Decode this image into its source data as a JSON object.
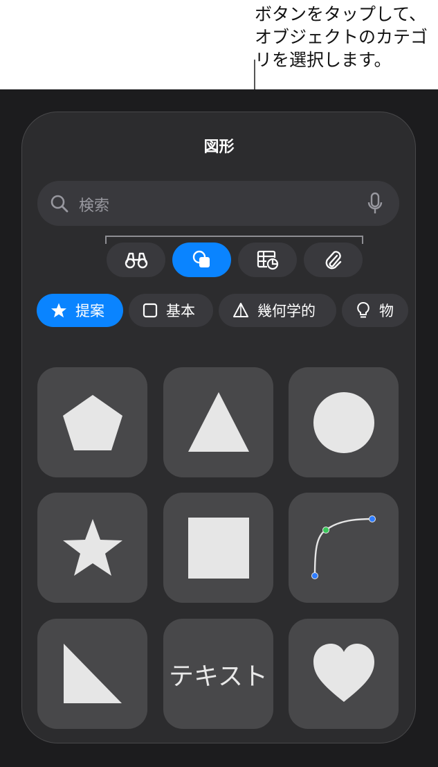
{
  "callout": {
    "text": "ボタンをタップして、\nオブジェクトのカテゴ\nリを選択します。"
  },
  "panel": {
    "title": "図形"
  },
  "search": {
    "placeholder": "検索"
  },
  "category_buttons": [
    {
      "icon": "binoculars-icon",
      "active": false
    },
    {
      "icon": "shapes-icon",
      "active": true
    },
    {
      "icon": "table-chart-icon",
      "active": false
    },
    {
      "icon": "paperclip-icon",
      "active": false
    }
  ],
  "chips": [
    {
      "label": "提案",
      "icon": "star-icon",
      "active": true
    },
    {
      "label": "基本",
      "icon": "square-icon",
      "active": false
    },
    {
      "label": "幾何学的",
      "icon": "pyramid-icon",
      "active": false
    },
    {
      "label": "物",
      "icon": "lightbulb-icon",
      "active": false
    }
  ],
  "shapes": [
    {
      "name": "pentagon"
    },
    {
      "name": "triangle"
    },
    {
      "name": "circle"
    },
    {
      "name": "star"
    },
    {
      "name": "square"
    },
    {
      "name": "curve"
    },
    {
      "name": "right-triangle"
    },
    {
      "name": "text",
      "label": "テキスト"
    },
    {
      "name": "heart"
    }
  ],
  "colors": {
    "accent": "#0a84ff",
    "panel_bg": "#2c2c2e",
    "tile_bg": "#48484a",
    "shape_fill": "#e6e6e6"
  }
}
